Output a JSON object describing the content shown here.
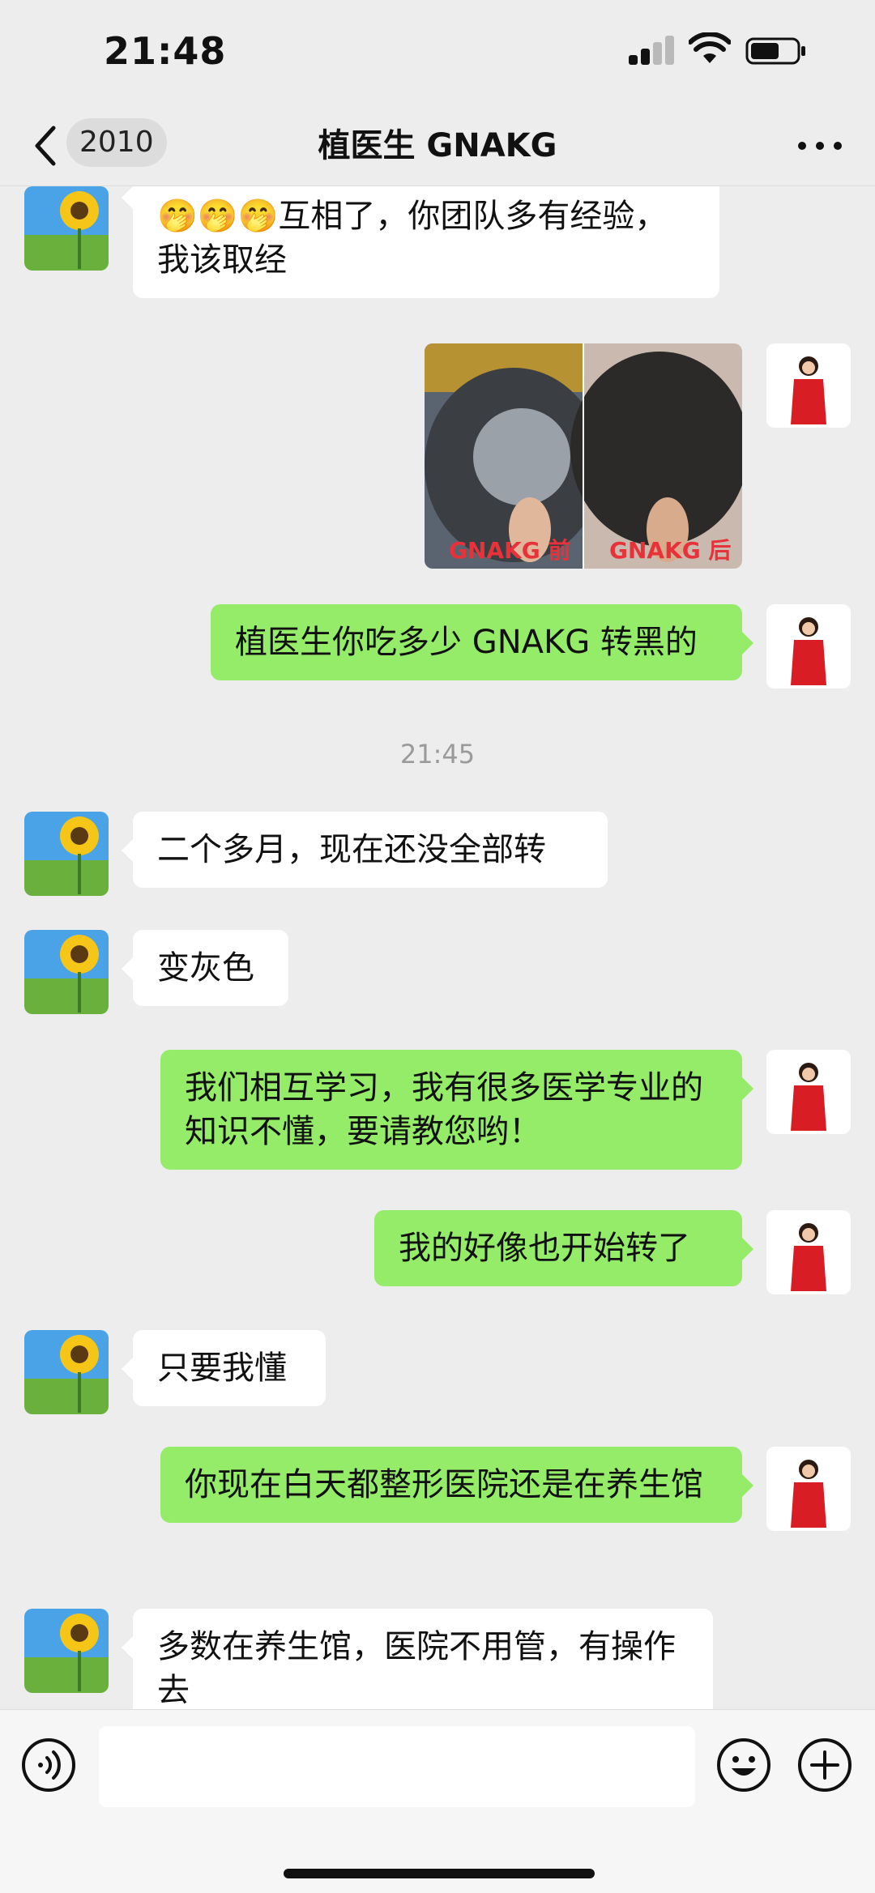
{
  "status_bar": {
    "time": "21:48"
  },
  "nav": {
    "unread_badge": "2010",
    "title": "植医生 GNAKG"
  },
  "messages": [
    {
      "side": "left",
      "text": "🤭🤭🤭互相了，你团队多有经验，我该取经"
    },
    {
      "side": "right",
      "type": "image",
      "labels": [
        "GNAKG 前",
        "GNAKG 后"
      ]
    },
    {
      "side": "right",
      "text": "植医生你吃多少 GNAKG 转黑的"
    },
    {
      "type": "timestamp",
      "text": "21:45"
    },
    {
      "side": "left",
      "text": "二个多月，现在还没全部转"
    },
    {
      "side": "left",
      "text": "变灰色"
    },
    {
      "side": "right",
      "text": "我们相互学习，我有很多医学专业的知识不懂，要请教您哟！"
    },
    {
      "side": "right",
      "text": "我的好像也开始转了"
    },
    {
      "side": "left",
      "text": "只要我懂"
    },
    {
      "side": "right",
      "text": "你现在白天都整形医院还是在养生馆"
    },
    {
      "side": "left",
      "text": "多数在养生馆，医院不用管，有操作去"
    }
  ],
  "input": {
    "placeholder": ""
  },
  "colors": {
    "bubble_self": "#95ec69",
    "bubble_other": "#ffffff",
    "background": "#ededed"
  }
}
